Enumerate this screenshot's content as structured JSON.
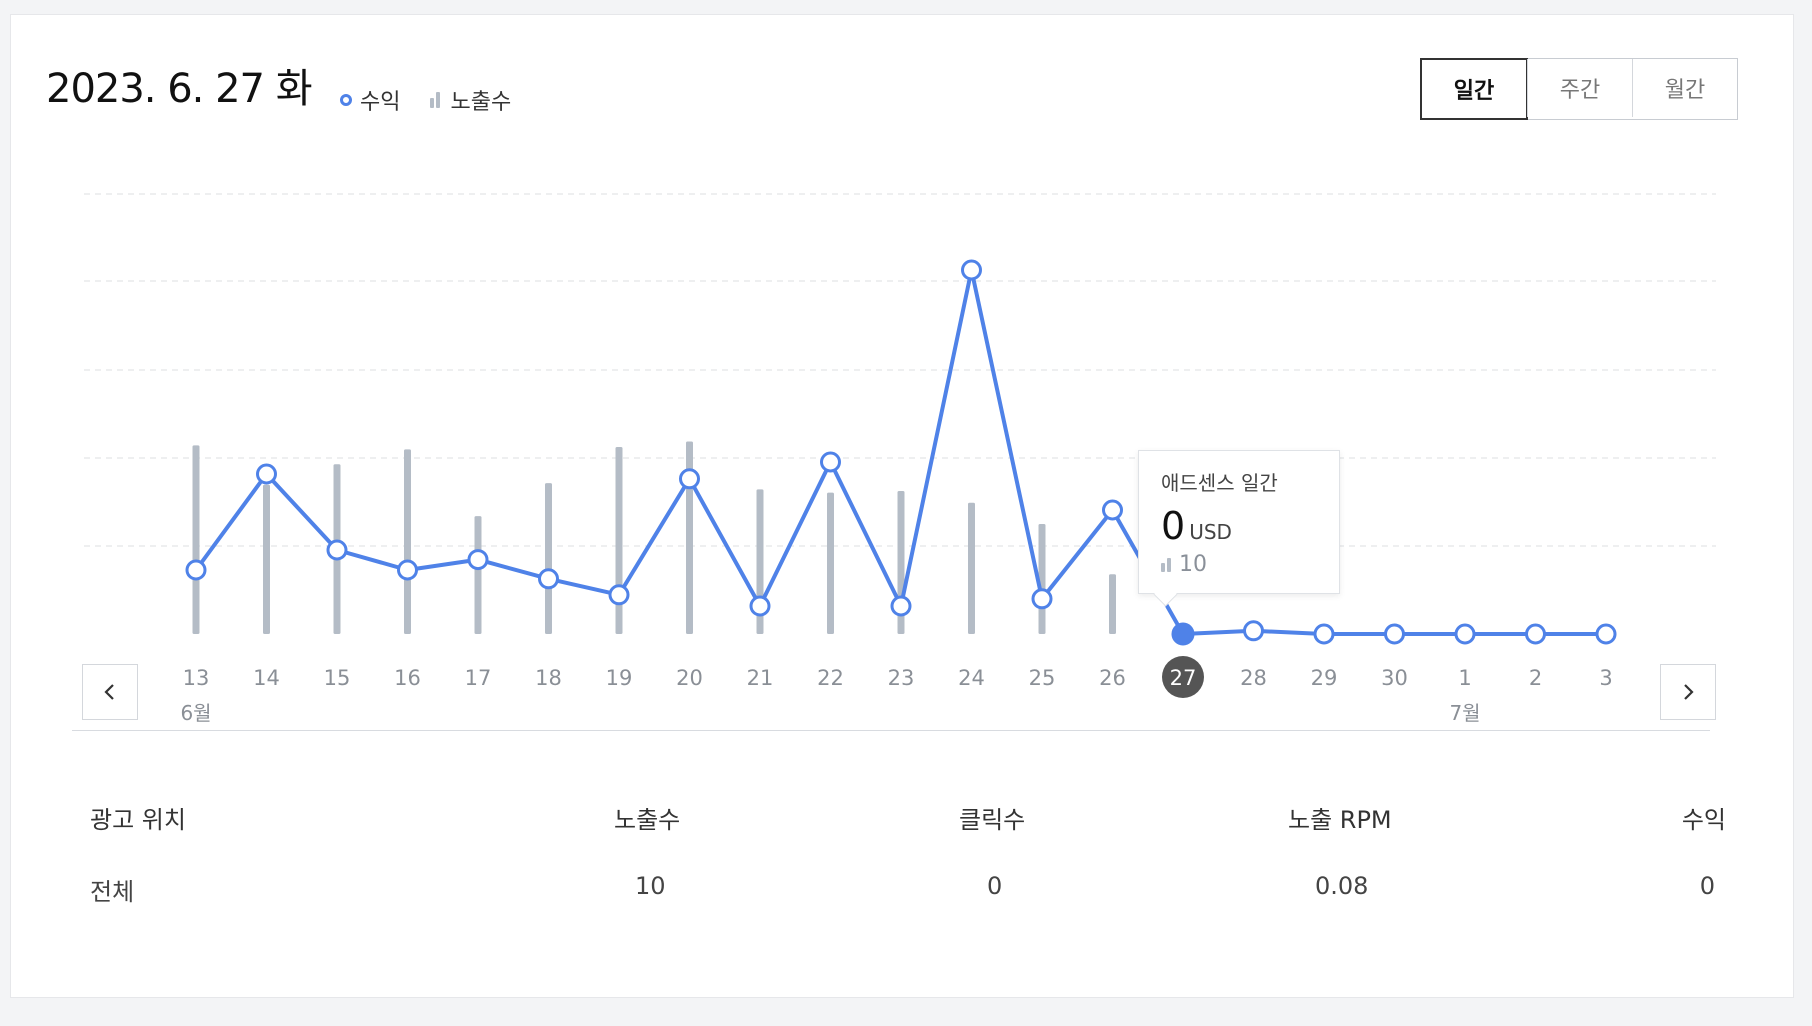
{
  "header": {
    "date": "2023. 6. 27 화",
    "legend": {
      "revenue": "수익",
      "impressions": "노출수"
    },
    "tabs": [
      {
        "label": "일간",
        "active": true
      },
      {
        "label": "주간",
        "active": false
      },
      {
        "label": "월간",
        "active": false
      }
    ]
  },
  "chart_data": {
    "type": "line",
    "categories": [
      "13",
      "14",
      "15",
      "16",
      "17",
      "18",
      "19",
      "20",
      "21",
      "22",
      "23",
      "24",
      "25",
      "26",
      "27",
      "28",
      "29",
      "30",
      "1",
      "2",
      "3"
    ],
    "month_labels": [
      {
        "text": "6월",
        "at": "13"
      },
      {
        "text": "7월",
        "at": "1"
      }
    ],
    "selected": "27",
    "series": [
      {
        "name": "수익",
        "kind": "line",
        "color": "#4f82e8",
        "values": [
          0.8,
          2.0,
          1.05,
          0.8,
          0.93,
          0.69,
          0.49,
          1.94,
          0.35,
          2.15,
          0.35,
          4.55,
          0.44,
          1.55,
          0,
          0.04,
          0,
          0,
          0,
          0,
          0
        ]
      },
      {
        "name": "노출수",
        "kind": "bar",
        "color": "#b4bcc6",
        "values": [
          240,
          190,
          216,
          235,
          150,
          192,
          238,
          245,
          184,
          180,
          182,
          167,
          140,
          76,
          null,
          null,
          null,
          null,
          null,
          null,
          null
        ]
      }
    ],
    "ylim_line": [
      0,
      5
    ],
    "ylim_bar": [
      0,
      560
    ],
    "grid": true,
    "legend_position": "top-left"
  },
  "tooltip": {
    "title": "애드센스 일간",
    "value": "0",
    "unit": "USD",
    "impressions": "10"
  },
  "nav": {
    "prev_icon": "chevron-left-icon",
    "next_icon": "chevron-right-icon"
  },
  "table": {
    "headers": [
      "광고 위치",
      "노출수",
      "클릭수",
      "노출 RPM",
      "수익"
    ],
    "rows": [
      [
        "전체",
        "10",
        "0",
        "0.08",
        "0"
      ]
    ]
  }
}
